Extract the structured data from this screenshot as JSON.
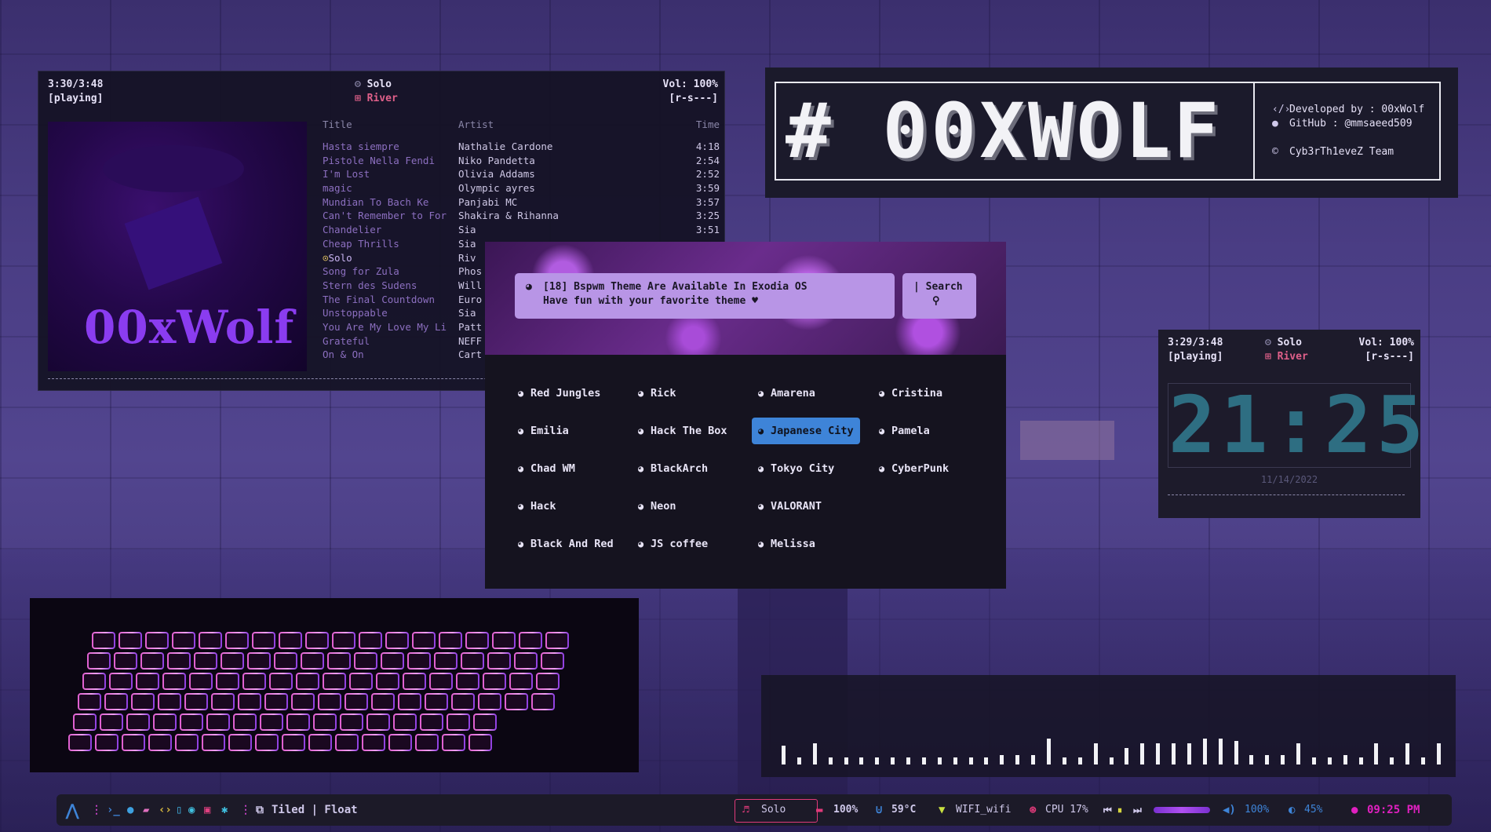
{
  "player_main": {
    "time": "3:30/3:48",
    "state": "[playing]",
    "track": "Solo",
    "artist": "River",
    "volume": "Vol: 100%",
    "flags": "[r-s---]",
    "cover_text": "00xWolf",
    "columns": {
      "title": "Title",
      "artist": "Artist",
      "time": "Time"
    },
    "tracks": [
      {
        "title": "Hasta siempre",
        "artist": "Nathalie Cardone",
        "time": "4:18"
      },
      {
        "title": "Pistole Nella Fendi",
        "artist": "Niko Pandetta",
        "time": "2:54"
      },
      {
        "title": "I'm Lost",
        "artist": "Olivia Addams",
        "time": "2:52"
      },
      {
        "title": "magic",
        "artist": "Olympic ayres",
        "time": "3:59"
      },
      {
        "title": "Mundian To Bach Ke",
        "artist": "Panjabi MC",
        "time": "3:57"
      },
      {
        "title": "Can't Remember to For",
        "artist": "Shakira & Rihanna",
        "time": "3:25"
      },
      {
        "title": "Chandelier",
        "artist": "Sia",
        "time": "3:51"
      },
      {
        "title": "Cheap Thrills",
        "artist": "Sia",
        "time": ""
      },
      {
        "title": "Solo",
        "artist": "Riv",
        "time": ""
      },
      {
        "title": "Song for Zula",
        "artist": "Phos",
        "time": ""
      },
      {
        "title": "Stern des Sudens",
        "artist": "Will",
        "time": ""
      },
      {
        "title": "The Final Countdown",
        "artist": "Euro",
        "time": ""
      },
      {
        "title": "Unstoppable",
        "artist": "Sia",
        "time": ""
      },
      {
        "title": "You Are My Love My Li",
        "artist": "Patt",
        "time": ""
      },
      {
        "title": "Grateful",
        "artist": "NEFF",
        "time": ""
      },
      {
        "title": "On & On",
        "artist": "Cart",
        "time": ""
      }
    ],
    "current_index": 8
  },
  "logo_panel": {
    "logo": "# 00XWOLF",
    "developer": "Developed by : 00xWolf",
    "github": "GitHub : @mmsaeed509",
    "team": "Cyb3rTh1eveZ Team"
  },
  "launcher": {
    "notice_line1": "[18] Bspwm Theme Are Available In Exodia OS",
    "notice_line2": "Have fun with your favorite theme ♥",
    "search_label": "Search",
    "themes": [
      "Red Jungles",
      "Rick",
      "Amarena",
      "Cristina",
      "Emilia",
      "Hack The Box",
      "Japanese City",
      "Pamela",
      "Chad WM",
      "BlackArch",
      "Tokyo City",
      "CyberPunk",
      "Hack",
      "Neon",
      "VALORANT",
      "",
      "Black And Red",
      "JS coffee",
      "Melissa",
      ""
    ],
    "selected": "Japanese City"
  },
  "player_clock": {
    "time": "3:29/3:48",
    "state": "[playing]",
    "track": "Solo",
    "artist": "River",
    "volume": "Vol: 100%",
    "flags": "[r-s---]",
    "clock": "21:25",
    "date": "11/14/2022"
  },
  "visualizer": {
    "levels": [
      0.4,
      0.15,
      0.45,
      0.15,
      0.15,
      0.15,
      0.15,
      0.15,
      0.15,
      0.15,
      0.15,
      0.15,
      0.15,
      0.15,
      0.2,
      0.2,
      0.2,
      0.55,
      0.15,
      0.15,
      0.45,
      0.15,
      0.35,
      0.45,
      0.45,
      0.45,
      0.45,
      0.55,
      0.55,
      0.5,
      0.2,
      0.2,
      0.2,
      0.45,
      0.15,
      0.15,
      0.2,
      0.15,
      0.45,
      0.15,
      0.45,
      0.15,
      0.45
    ]
  },
  "taskbar": {
    "layout": "Tiled | Float",
    "now_playing": "Solo",
    "battery": "100%",
    "temp": "59°C",
    "wifi": "WIFI_wifi",
    "cpu": "CPU 17%",
    "volume": "100%",
    "brightness": "45%",
    "clock": "09:25 PM",
    "colors": {
      "accent_pink": "#e03a7a",
      "accent_blue": "#3e84d8",
      "clock_teal": "#2e6e82"
    }
  }
}
